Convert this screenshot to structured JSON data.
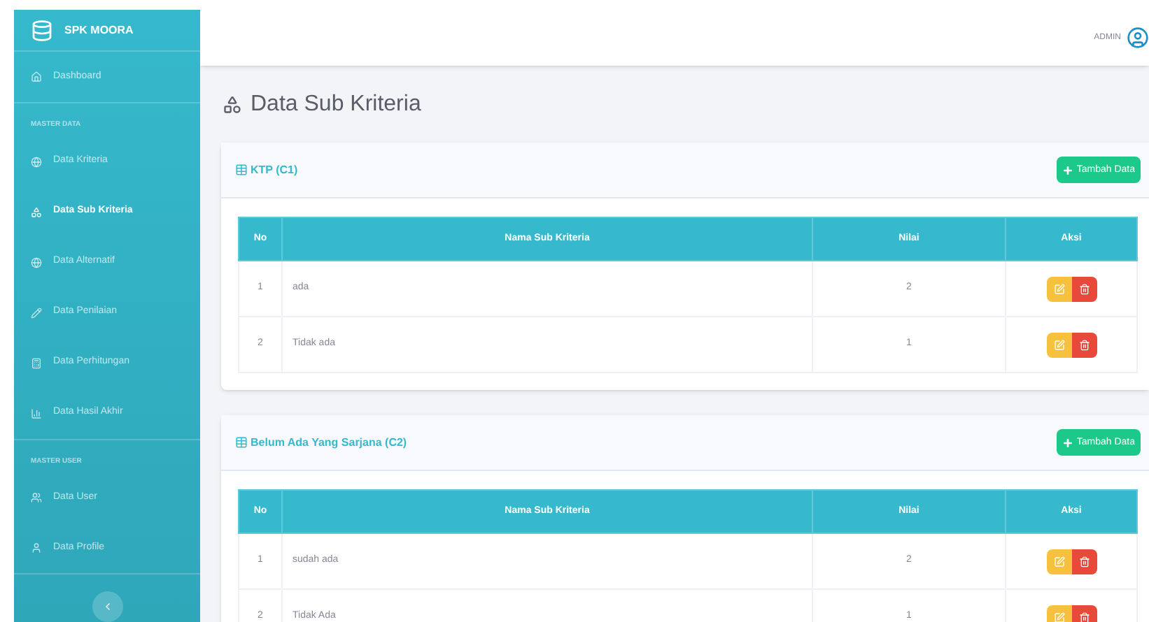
{
  "sidebar": {
    "brand": "SPK MOORA",
    "sections": [
      {
        "items": [
          {
            "label": "Dashboard",
            "selected": false
          }
        ]
      },
      {
        "heading": "MASTER DATA",
        "items": [
          {
            "label": "Data Kriteria",
            "selected": false
          },
          {
            "label": "Data Sub Kriteria",
            "selected": true
          },
          {
            "label": "Data Alternatif",
            "selected": false
          },
          {
            "label": "Data Penilaian",
            "selected": false
          },
          {
            "label": "Data Perhitungan",
            "selected": false
          },
          {
            "label": "Data Hasil Akhir",
            "selected": false
          }
        ]
      },
      {
        "heading": "MASTER USER",
        "items": [
          {
            "label": "Data User",
            "selected": false
          },
          {
            "label": "Data Profile",
            "selected": false
          }
        ]
      }
    ]
  },
  "topbar": {
    "user": "ADMIN"
  },
  "page_title": "Data Sub Kriteria",
  "cards": [
    {
      "title": "KTP (C1)",
      "button": "Tambah Data",
      "columns": [
        "No",
        "Nama Sub Kriteria",
        "Nilai",
        "Aksi"
      ],
      "rows": [
        {
          "no": "1",
          "name": "ada",
          "value": "2"
        },
        {
          "no": "2",
          "name": "Tidak ada",
          "value": "1"
        }
      ]
    },
    {
      "title": "Belum Ada Yang Sarjana (C2)",
      "button": "Tambah Data",
      "columns": [
        "No",
        "Nama Sub Kriteria",
        "Nilai",
        "Aksi"
      ],
      "rows": [
        {
          "no": "1",
          "name": "sudah ada",
          "value": "2"
        },
        {
          "no": "2",
          "name": "Tidak Ada",
          "value": "1"
        }
      ]
    }
  ]
}
